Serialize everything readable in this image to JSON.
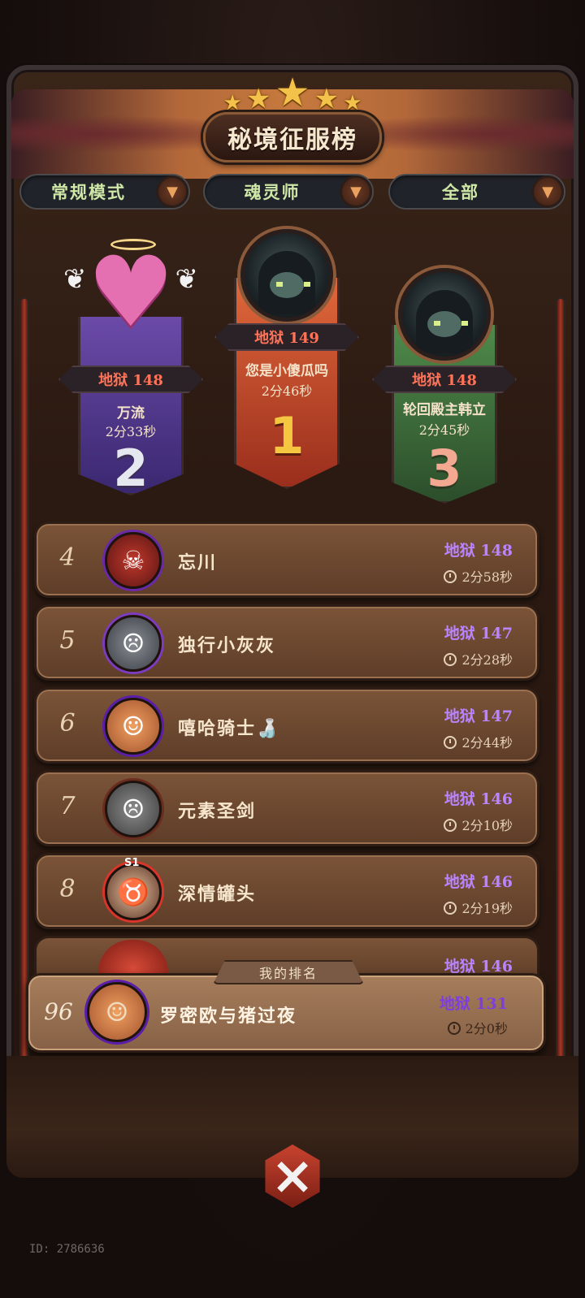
{
  "title": "秘境征服榜",
  "filters": [
    {
      "label": "常规模式"
    },
    {
      "label": "魂灵师"
    },
    {
      "label": "全部"
    }
  ],
  "podium": {
    "first": {
      "rank": "1",
      "floor": "地狱 149",
      "name": "您是小傻瓜吗",
      "time": "2分46秒"
    },
    "second": {
      "rank": "2",
      "floor": "地狱 148",
      "name": "万流",
      "time": "2分33秒"
    },
    "third": {
      "rank": "3",
      "floor": "地狱 148",
      "name": "轮回殿主韩立",
      "time": "2分45秒"
    }
  },
  "rows": [
    {
      "rank": "4",
      "name": "忘川",
      "floor": "地狱 148",
      "time": "2分58秒"
    },
    {
      "rank": "5",
      "name": "独行小灰灰",
      "floor": "地狱 147",
      "time": "2分28秒"
    },
    {
      "rank": "6",
      "name": "嘻哈骑士🍶",
      "floor": "地狱 147",
      "time": "2分44秒"
    },
    {
      "rank": "7",
      "name": "元素圣剑",
      "floor": "地狱 146",
      "time": "2分10秒"
    },
    {
      "rank": "8",
      "name": "深情罐头",
      "floor": "地狱 146",
      "time": "2分19秒"
    }
  ],
  "partial_row": {
    "floor": "地狱 146"
  },
  "my_rank": {
    "tag": "我的排名",
    "rank": "96",
    "name": "罗密欧与猪过夜",
    "floor": "地狱 131",
    "time": "2分0秒"
  },
  "avatar_badge": "S1",
  "uid": "ID: 2786636",
  "colors": {
    "floor_purple": "#b984ff",
    "floor_red": "#ff7358",
    "filter_text": "#cfe7a6"
  }
}
